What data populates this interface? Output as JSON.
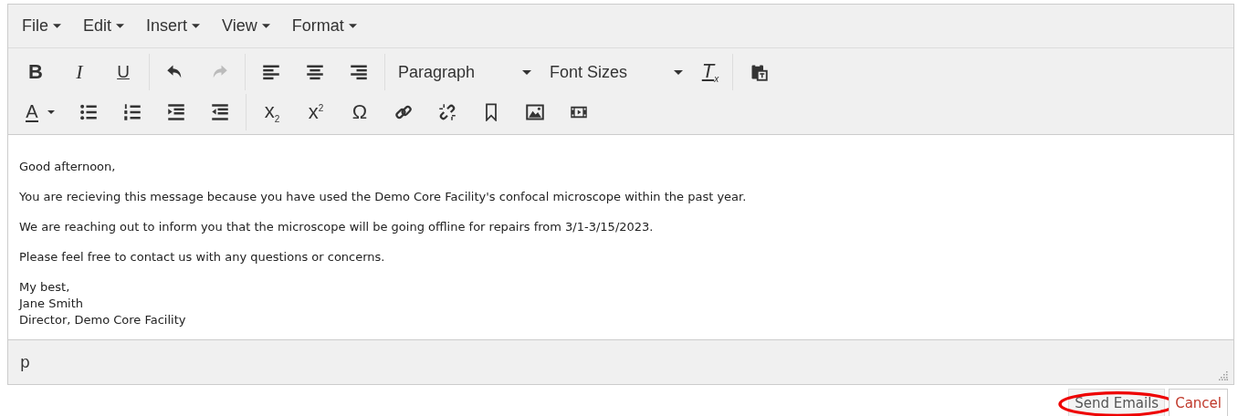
{
  "menu_bar": [
    {
      "label": "File"
    },
    {
      "label": "Edit"
    },
    {
      "label": "Insert"
    },
    {
      "label": "View"
    },
    {
      "label": "Format"
    }
  ],
  "toolbar": {
    "row_1": [
      {
        "kind": "glyph",
        "label": "B",
        "disabled": false
      },
      {
        "kind": "glyph",
        "label": "I",
        "disabled": false
      },
      {
        "kind": "glyph",
        "label": "U",
        "disabled": false
      },
      {
        "kind": "separator"
      },
      {
        "kind": "icon",
        "disabled": false
      },
      {
        "kind": "icon",
        "disabled": true
      },
      {
        "kind": "separator"
      },
      {
        "kind": "icon",
        "disabled": false
      },
      {
        "kind": "icon",
        "disabled": false
      },
      {
        "kind": "icon",
        "disabled": false
      },
      {
        "kind": "separator"
      },
      {
        "kind": "select",
        "label": "Paragraph",
        "disabled": false
      },
      {
        "kind": "select",
        "label": "Font Sizes",
        "disabled": false
      },
      {
        "kind": "glyph",
        "label": "T$_{x}$",
        "disabled": false
      },
      {
        "kind": "separator"
      },
      {
        "kind": "icon",
        "disabled": false
      }
    ],
    "row_2": [
      {
        "kind": "split",
        "label": "A",
        "disabled": false
      },
      {
        "kind": "icon",
        "disabled": false
      },
      {
        "kind": "icon",
        "disabled": false
      },
      {
        "kind": "icon",
        "disabled": false
      },
      {
        "kind": "icon",
        "disabled": false
      },
      {
        "kind": "separator"
      },
      {
        "kind": "glyph",
        "label": "x$_{2}$",
        "disabled": false
      },
      {
        "kind": "glyph",
        "label": "x$^{2}$",
        "disabled": false
      },
      {
        "kind": "glyph",
        "label": "Ω",
        "disabled": false
      },
      {
        "kind": "icon",
        "disabled": false
      },
      {
        "kind": "icon",
        "disabled": false
      },
      {
        "kind": "icon",
        "disabled": false
      },
      {
        "kind": "icon",
        "disabled": false
      },
      {
        "kind": "icon",
        "disabled": false
      }
    ]
  },
  "content": {
    "paragraphs": [
      {
        "lines": [
          "Good afternoon,"
        ]
      },
      {
        "lines": [
          "You are recieving this message because you have used the Demo Core Facility's confocal microscope within the past year."
        ]
      },
      {
        "lines": [
          "We are reaching out to inform you that the microscope will be going offline for repairs from 3/1-3/15/2023."
        ]
      },
      {
        "lines": [
          "Please feel free to contact us with any questions or concerns."
        ]
      },
      {
        "lines": [
          "My best,",
          "Jane Smith",
          "Director, Demo Core Facility"
        ]
      }
    ]
  },
  "status_bar": {
    "path": "p"
  },
  "buttons": [
    {
      "label": "Send Emails",
      "kind": "primary",
      "highlighted": true
    },
    {
      "label": "Cancel",
      "kind": "cancel",
      "highlighted": false
    }
  ]
}
